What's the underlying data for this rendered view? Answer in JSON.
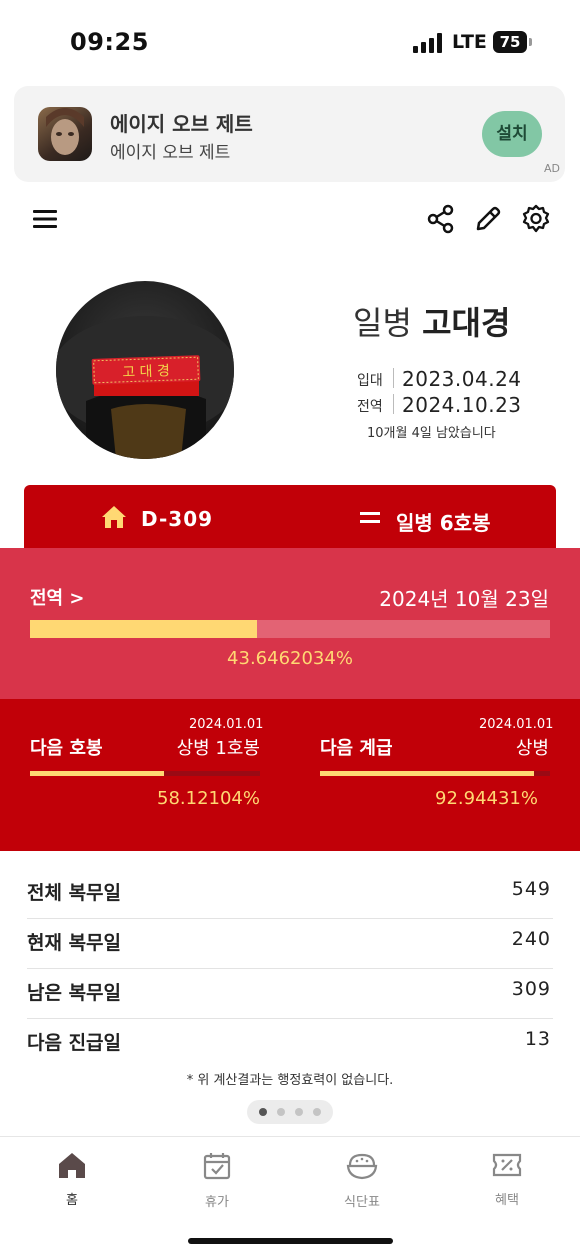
{
  "status_bar": {
    "time": "09:25",
    "network": "LTE",
    "battery": "75"
  },
  "ad": {
    "title": "에이지 오브 제트",
    "subtitle": "에이지 오브 제트",
    "install_label": "설치",
    "tag": "AD"
  },
  "toolbar": {
    "icons": [
      "menu-icon",
      "share-icon",
      "edit-icon",
      "settings-icon"
    ]
  },
  "profile": {
    "rank": "일병",
    "name": "고대경",
    "enlist_label": "입대",
    "enlist_date": "2023.04.24",
    "discharge_label": "전역",
    "discharge_date": "2024.10.23",
    "remaining_text": "10개월 4일 남았습니다"
  },
  "summary": {
    "dday": "D-309",
    "hobong": "일병 6호봉"
  },
  "discharge_progress": {
    "label": "전역 >",
    "date": "2024년 10월 23일",
    "percent_text": "43.6462034%",
    "fraction": 0.436462034
  },
  "next_hobong": {
    "label": "다음 호봉",
    "date": "2024.01.01",
    "target": "상병 1호봉",
    "percent_text": "58.12104%",
    "fraction": 0.5812104
  },
  "next_rank": {
    "label": "다음 계급",
    "date": "2024.01.01",
    "target": "상병",
    "percent_text": "92.94431%",
    "fraction": 0.9294431
  },
  "stats": [
    {
      "label": "전체 복무일",
      "value": "549"
    },
    {
      "label": "현재 복무일",
      "value": "240"
    },
    {
      "label": "남은 복무일",
      "value": "309"
    },
    {
      "label": "다음 진급일",
      "value": "13"
    }
  ],
  "note": "* 위 계산결과는 행정효력이 없습니다.",
  "pager": {
    "count": 4,
    "active_index": 0
  },
  "tabs": [
    {
      "label": "홈",
      "icon": "home-icon",
      "active": true
    },
    {
      "label": "휴가",
      "icon": "calendar-icon",
      "active": false
    },
    {
      "label": "식단표",
      "icon": "rice-bowl-icon",
      "active": false
    },
    {
      "label": "혜택",
      "icon": "ticket-icon",
      "active": false
    }
  ],
  "colors": {
    "primary_red": "#c10008",
    "pink_red": "#d8344a",
    "progress_yellow": "#ffd873",
    "install_green": "#82c7a5"
  }
}
